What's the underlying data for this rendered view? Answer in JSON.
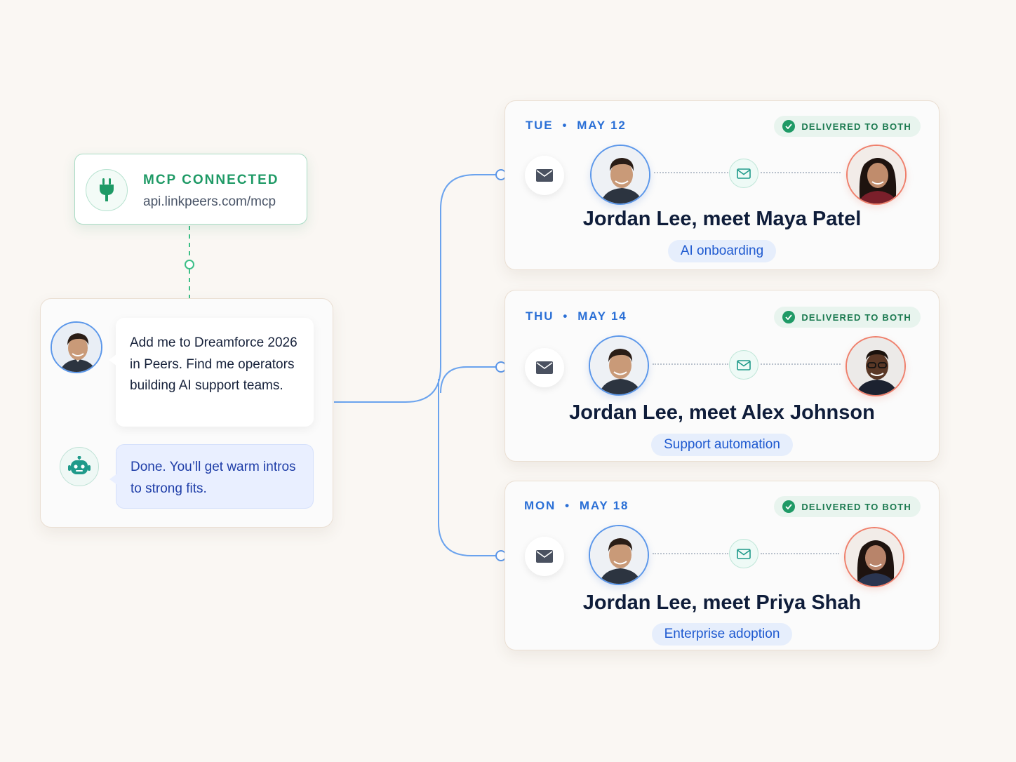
{
  "mcp": {
    "status": "MCP CONNECTED",
    "url": "api.linkpeers.com/mcp",
    "icon": "plug-icon"
  },
  "chat": {
    "user_message": "Add me to Dreamforce 2026 in Peers. Find me operators building AI support teams.",
    "bot_message": "Done. You’ll get warm intros to strong fits."
  },
  "intros": [
    {
      "day": "TUE",
      "date": "MAY 12",
      "status": "DELIVERED TO BOTH",
      "title": "Jordan Lee, meet Maya Patel",
      "tag": "AI onboarding"
    },
    {
      "day": "THU",
      "date": "MAY 14",
      "status": "DELIVERED TO BOTH",
      "title": "Jordan Lee, meet Alex Johnson",
      "tag": "Support automation"
    },
    {
      "day": "MON",
      "date": "MAY 18",
      "status": "DELIVERED TO BOTH",
      "title": "Jordan Lee, meet Priya Shah",
      "tag": "Enterprise adoption"
    }
  ],
  "colors": {
    "accent_blue": "#2a6fd6",
    "accent_green": "#1f9a66",
    "background": "#faf7f3"
  }
}
